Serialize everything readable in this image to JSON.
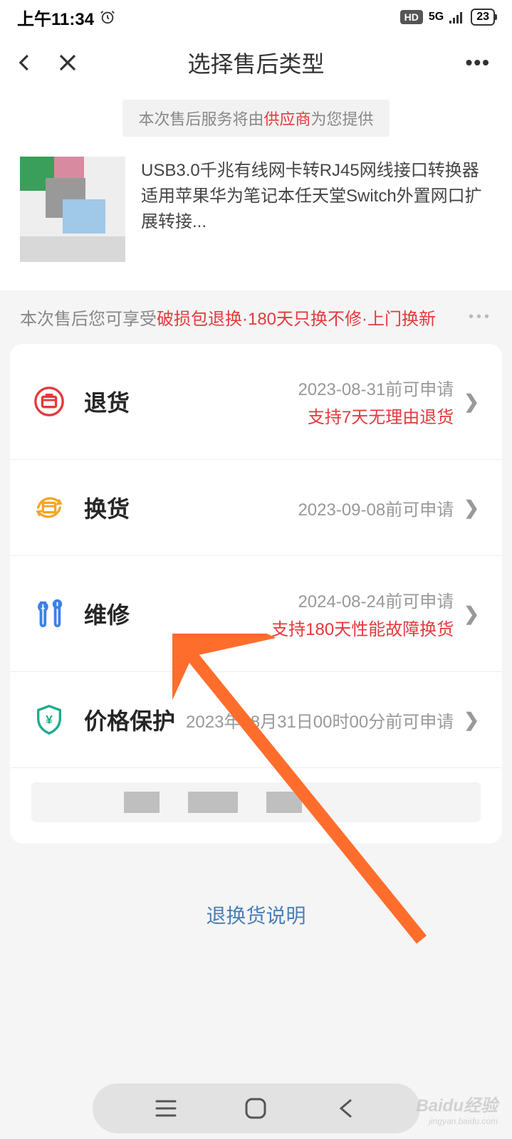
{
  "status": {
    "time": "上午11:34",
    "hd": "HD",
    "net": "5G",
    "battery": "23"
  },
  "header": {
    "title": "选择售后类型"
  },
  "notice": {
    "prefix": "本次售后服务将由",
    "provider": "供应商",
    "suffix": "为您提供"
  },
  "product": {
    "desc": "USB3.0千兆有线网卡转RJ45网线接口转换器 适用苹果华为笔记本任天堂Switch外置网口扩展转接..."
  },
  "privilege": {
    "prefix": "本次售后您可享受",
    "perks": "破损包退换·180天只换不修·上门换新"
  },
  "options": [
    {
      "label": "退货",
      "date": "2023-08-31前可申请",
      "extra": "支持7天无理由退货",
      "icon": "return",
      "iconColor": "#e4393c"
    },
    {
      "label": "换货",
      "date": "2023-09-08前可申请",
      "extra": "",
      "icon": "exchange",
      "iconColor": "#f5a623"
    },
    {
      "label": "维修",
      "date": "2024-08-24前可申请",
      "extra": "支持180天性能故障换货",
      "icon": "repair",
      "iconColor": "#3b82e6"
    },
    {
      "label": "价格保护",
      "date": "2023年08月31日00时00分前可申请",
      "extra": "",
      "icon": "price",
      "iconColor": "#1aad8d"
    }
  ],
  "footer": {
    "link": "退换货说明"
  },
  "watermark": {
    "brand": "Baidu经验",
    "sub": "jingyan.baidu.com"
  }
}
